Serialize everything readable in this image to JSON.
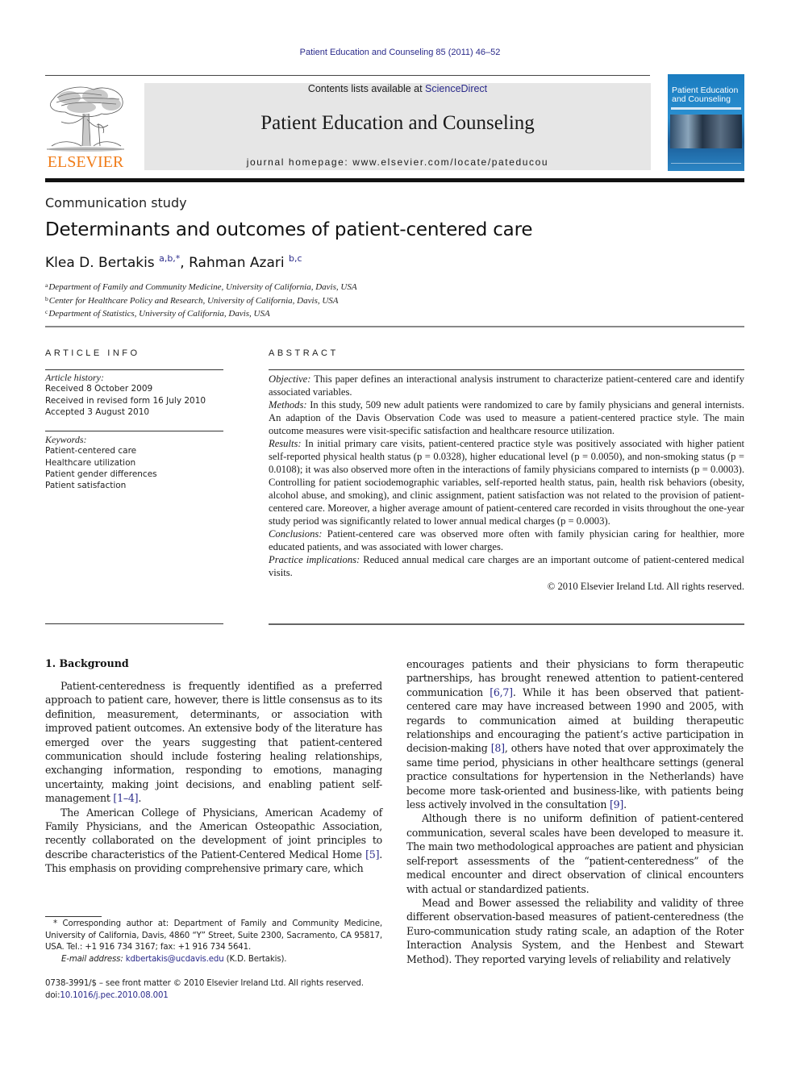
{
  "running_head": "Patient Education and Counseling 85 (2011) 46–52",
  "masthead": {
    "contents_prefix": "Contents lists available at ",
    "contents_link": "ScienceDirect",
    "journal_name": "Patient Education and Counseling",
    "homepage": "journal homepage: www.elsevier.com/locate/pateducou",
    "publisher_logo": "ELSEVIER",
    "cover_title_line1": "Patient Education",
    "cover_title_line2": "and Counseling"
  },
  "colors": {
    "link": "#2a2a8a",
    "elsevier_orange": "#f07d1a",
    "masthead_bg": "#e6e6e6",
    "cover_blue": "#1a7cc0"
  },
  "article": {
    "section_label": "Communication study",
    "title": "Determinants and outcomes of patient-centered care",
    "authors": [
      {
        "name": "Klea D. Bertakis",
        "sup": "a,b,*"
      },
      {
        "name": "Rahman Azari",
        "sup": "b,c"
      }
    ],
    "author_separator": ", ",
    "affiliations": [
      {
        "key": "a",
        "text": "Department of Family and Community Medicine, University of California, Davis, USA"
      },
      {
        "key": "b",
        "text": "Center for Healthcare Policy and Research, University of California, Davis, USA"
      },
      {
        "key": "c",
        "text": "Department of Statistics, University of California, Davis, USA"
      }
    ]
  },
  "article_info": {
    "heading": "ARTICLE INFO",
    "history_label": "Article history:",
    "history": [
      "Received 8 October 2009",
      "Received in revised form 16 July 2010",
      "Accepted 3 August 2010"
    ],
    "keywords_label": "Keywords:",
    "keywords": [
      "Patient-centered care",
      "Healthcare utilization",
      "Patient gender differences",
      "Patient satisfaction"
    ]
  },
  "abstract": {
    "heading": "ABSTRACT",
    "sections": [
      {
        "label": "Objective:",
        "text": " This paper defines an interactional analysis instrument to characterize patient-centered care and identify associated variables."
      },
      {
        "label": "Methods:",
        "text": " In this study, 509 new adult patients were randomized to care by family physicians and general internists. An adaption of the Davis Observation Code was used to measure a patient-centered practice style. The main outcome measures were visit-specific satisfaction and healthcare resource utilization."
      },
      {
        "label": "Results:",
        "text": " In initial primary care visits, patient-centered practice style was positively associated with higher patient self-reported physical health status (p = 0.0328), higher educational level (p = 0.0050), and non-smoking status (p = 0.0108); it was also observed more often in the interactions of family physicians compared to internists (p = 0.0003). Controlling for patient sociodemographic variables, self-reported health status, pain, health risk behaviors (obesity, alcohol abuse, and smoking), and clinic assignment, patient satisfaction was not related to the provision of patient-centered care. Moreover, a higher average amount of patient-centered care recorded in visits throughout the one-year study period was significantly related to lower annual medical charges (p = 0.0003)."
      },
      {
        "label": "Conclusions:",
        "text": "  Patient-centered care was observed more often with family physician caring for healthier, more educated patients, and was associated with lower charges."
      },
      {
        "label": "Practice implications:",
        "text": " Reduced annual medical care charges are an important outcome of patient-centered medical visits."
      }
    ],
    "copyright": "© 2010 Elsevier Ireland Ltd. All rights reserved."
  },
  "body": {
    "section_heading": "1.  Background",
    "left_paragraphs": [
      {
        "text": "Patient-centeredness is frequently identified as a preferred approach to patient care, however, there is little consensus as to its definition, measurement, determinants, or association with improved patient outcomes. An extensive body of the literature has emerged over the years suggesting that patient-centered communication should include fostering healing relationships, exchanging information, responding to emotions, managing uncertainty, making joint decisions, and enabling patient self-management ",
        "cite": "[1–4]",
        "after": "."
      },
      {
        "text": "The American College of Physicians, American Academy of Family Physicians, and the American Osteopathic Association, recently collaborated on the development of joint principles to describe characteristics of the Patient-Centered Medical Home ",
        "cite": "[5]",
        "after": ". This emphasis on providing comprehensive primary care, which"
      }
    ],
    "right_paragraphs": [
      {
        "text": "encourages patients and their physicians to form therapeutic partnerships, has brought renewed attention to patient-centered communication ",
        "cite": "[6,7]",
        "mid": ". While it has been observed that patient-centered care may have increased between 1990 and 2005, with regards to communication aimed at building therapeutic relationships and encouraging the patient’s active participation in decision-making ",
        "cite2": "[8]",
        "mid2": ", others have noted that over approximately the same time period, physicians in other healthcare settings (general practice consultations for hypertension in the Netherlands) have become more task-oriented and business-like, with patients being less actively involved in the consultation ",
        "cite3": "[9]",
        "after": "."
      },
      {
        "text": "Although there is no uniform definition of patient-centered communication, several scales have been developed to measure it. The main two methodological approaches are patient and physician self-report assessments of the “patient-centeredness” of the medical encounter and direct observation of clinical encounters with actual or standardized patients."
      },
      {
        "text": "Mead and Bower assessed the reliability and validity of three different observation-based measures of patient-centeredness (the Euro-communication study rating scale, an adaption of the Roter Interaction Analysis System, and the Henbest and Stewart Method). They reported varying levels of reliability and relatively"
      }
    ]
  },
  "footnotes": {
    "corresponding": "* Corresponding author at: Department of Family and Community Medicine, University of California, Davis, 4860 “Y” Street, Suite 2300, Sacramento, CA 95817, USA. Tel.: +1 916 734 3167; fax: +1 916 734 5641.",
    "email_label": "E-mail address:",
    "email": "kdbertakis@ucdavis.edu",
    "email_owner": " (K.D. Bertakis)."
  },
  "front_matter": {
    "issn_line": "0738-3991/$ – see front matter © 2010 Elsevier Ireland Ltd. All rights reserved.",
    "doi_prefix": "doi:",
    "doi": "10.1016/j.pec.2010.08.001"
  }
}
